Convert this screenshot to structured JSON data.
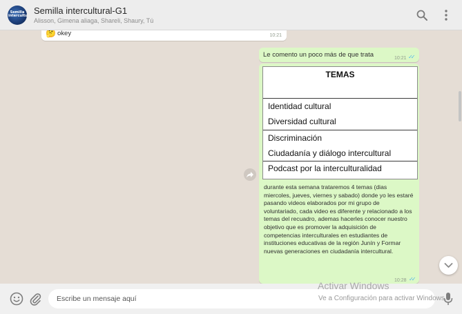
{
  "header": {
    "title": "Semilla intercultural-G1",
    "members": "Alisson, Gimena aliaga, Shareli, Shaury, Tú",
    "avatar_text": "Semilla intercultural"
  },
  "messages": {
    "prev": {
      "emoji": "🤔",
      "text": "okey",
      "time": "10:21"
    },
    "intro": {
      "text": "Le comento un poco más de que trata",
      "time": "10:21"
    },
    "image": {
      "title": "TEMAS",
      "rows": [
        "Identidad cultural",
        "Diversidad cultural",
        "Discriminación",
        "Ciudadanía y diálogo intercultural",
        "Podcast por la interculturalidad"
      ]
    },
    "caption": {
      "text": "durante esta semana trataremos  4 temas (dias miercoles, jueves, viernes y sabado) donde yo les estaré pasando  videos elaborados por mi grupo de voluntariado, cada video es diferente y relacionado a los temas del recuadro, ademas hacerles conocer nuestro objetivo que es promover la adquisición de competencias interculturales en estudiantes de instituciones educativas de la región Junín  y  Formar nuevas generaciones en ciudadanía intercultural.",
      "time": "10:28"
    }
  },
  "composer": {
    "placeholder": "Escribe un mensaje aquí"
  },
  "watermark": {
    "line1": "Activar Windows",
    "line2": "Ve a Configuración para activar Windows."
  },
  "icons": {
    "search": "search-icon",
    "menu": "kebab-menu-icon",
    "emoji": "emoji-icon",
    "attach": "paperclip-icon",
    "mic": "microphone-icon",
    "forward": "forward-icon",
    "scroll": "chevron-down-icon"
  },
  "colors": {
    "header_bg": "#ededed",
    "chat_bg": "#e5ddd5",
    "outgoing_bubble": "#dcf8c6",
    "incoming_bubble": "#ffffff",
    "read_ticks": "#4fb6ec"
  }
}
